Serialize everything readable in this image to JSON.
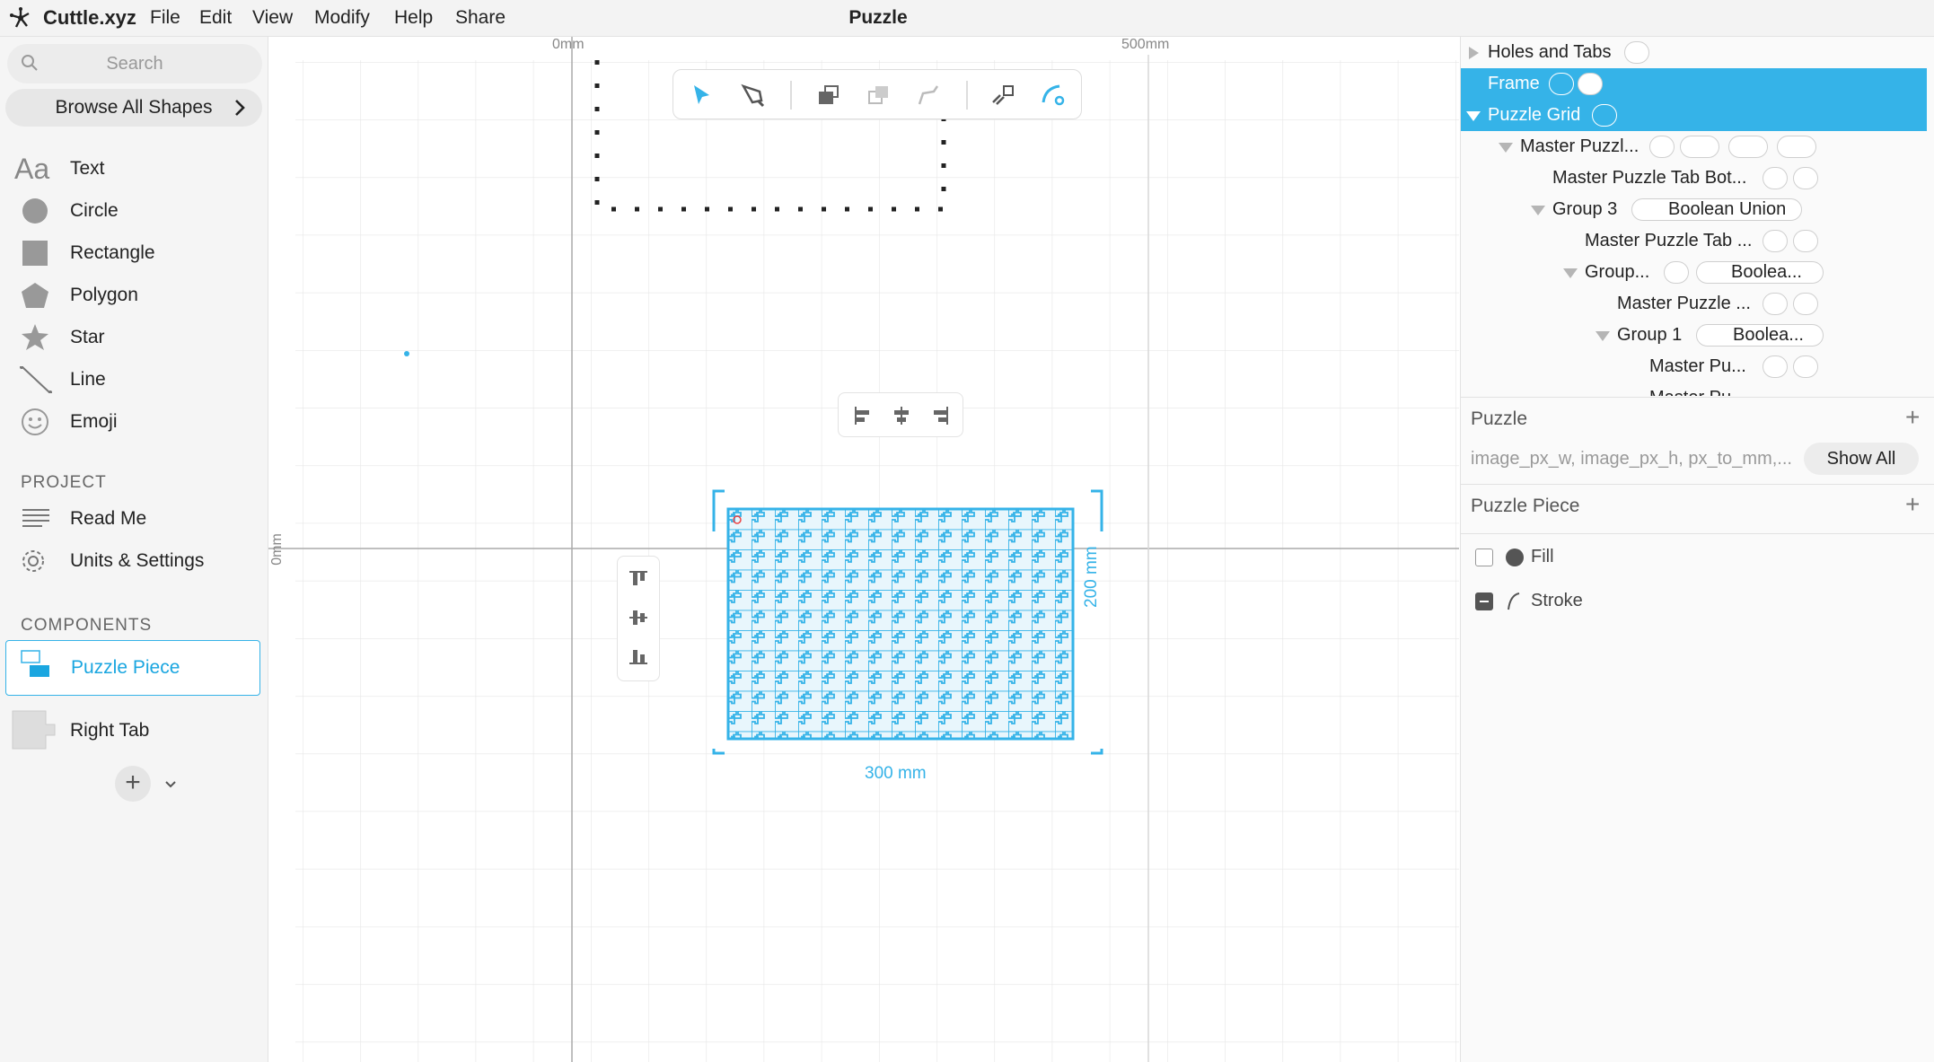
{
  "app": {
    "name": "Cuttle.xyz",
    "document_title": "Puzzle"
  },
  "menu": [
    "File",
    "Edit",
    "View",
    "Modify",
    "Help",
    "Share"
  ],
  "sidebar": {
    "search_placeholder": "Search",
    "browse_label": "Browse All Shapes",
    "shapes": [
      {
        "label": "Text",
        "icon": "text-icon"
      },
      {
        "label": "Circle",
        "icon": "circle-icon"
      },
      {
        "label": "Rectangle",
        "icon": "rectangle-icon"
      },
      {
        "label": "Polygon",
        "icon": "polygon-icon"
      },
      {
        "label": "Star",
        "icon": "star-icon"
      },
      {
        "label": "Line",
        "icon": "line-icon"
      },
      {
        "label": "Emoji",
        "icon": "emoji-icon"
      }
    ],
    "project_heading": "PROJECT",
    "project_items": [
      {
        "label": "Read Me",
        "icon": "document-icon"
      },
      {
        "label": "Units & Settings",
        "icon": "gear-icon"
      }
    ],
    "components_heading": "COMPONENTS",
    "components": [
      {
        "label": "Puzzle Piece",
        "selected": true
      },
      {
        "label": "Right Tab",
        "selected": false
      }
    ]
  },
  "canvas": {
    "ruler_top": [
      "0mm",
      "500mm"
    ],
    "ruler_left": [
      "0mm"
    ],
    "dim_width": "300 mm",
    "dim_height": "200 mm",
    "accent": "#35b3e8"
  },
  "right_panel": {
    "tree": [
      {
        "label": "Holes and Tabs",
        "indent": 0,
        "toggle": "collapsed",
        "selected": false
      },
      {
        "label": "Frame",
        "indent": 0,
        "toggle": "none",
        "selected": true
      },
      {
        "label": "Puzzle Grid",
        "indent": 0,
        "toggle": "expanded",
        "selected": true
      },
      {
        "label": "Master Puzzl...",
        "indent": 1,
        "toggle": "expanded",
        "selected": false
      },
      {
        "label": "Master Puzzle Tab Bot...",
        "indent": 2,
        "toggle": "none",
        "selected": false
      },
      {
        "label": "Group 3",
        "indent": 2,
        "toggle": "expanded",
        "selected": false,
        "pill": "Boolean Union"
      },
      {
        "label": "Master Puzzle Tab ...",
        "indent": 3,
        "toggle": "none",
        "selected": false
      },
      {
        "label": "Group...",
        "indent": 3,
        "toggle": "expanded",
        "selected": false,
        "pill": "Boolea..."
      },
      {
        "label": "Master Puzzle ...",
        "indent": 4,
        "toggle": "none",
        "selected": false
      },
      {
        "label": "Group 1",
        "indent": 4,
        "toggle": "expanded",
        "selected": false,
        "pill": "Boolea..."
      },
      {
        "label": "Master Pu...",
        "indent": 5,
        "toggle": "none",
        "selected": false
      },
      {
        "label": "Master Pu...",
        "indent": 5,
        "toggle": "none",
        "selected": false
      }
    ],
    "puzzle_heading": "Puzzle",
    "puzzle_params": "image_px_w, image_px_h, px_to_mm,...",
    "show_all": "Show All",
    "piece_heading": "Puzzle Piece",
    "fill_label": "Fill",
    "stroke_label": "Stroke"
  }
}
